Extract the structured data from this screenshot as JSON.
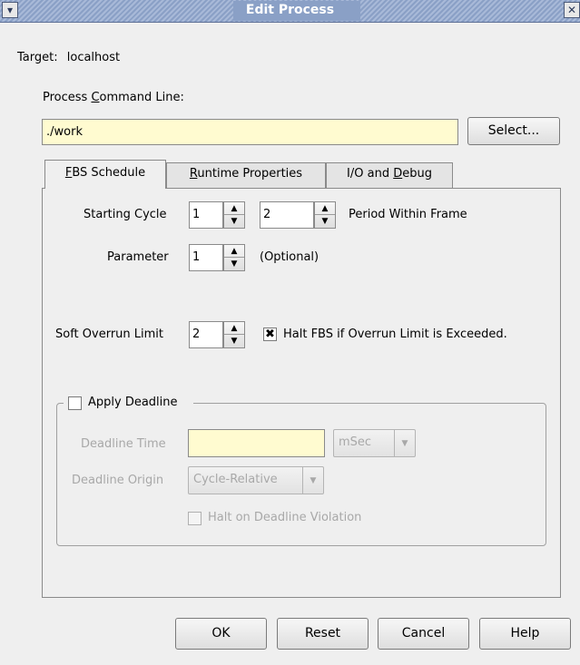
{
  "window": {
    "title": "Edit Process",
    "menu_glyph": "▾",
    "close_glyph": "✕"
  },
  "target": {
    "label": "Target:",
    "value": "localhost"
  },
  "command_line": {
    "label_before": "Process ",
    "label_mnemonic": "C",
    "label_after": "ommand Line:",
    "value": "./work",
    "select_button": "Select..."
  },
  "tabs": [
    {
      "mnemonic": "F",
      "rest": "BS Schedule",
      "prefix": "",
      "active": true
    },
    {
      "mnemonic": "R",
      "rest": "untime Properties",
      "prefix": "",
      "active": false
    },
    {
      "mnemonic": "D",
      "rest": "ebug",
      "prefix": "I/O and ",
      "active": false
    }
  ],
  "schedule": {
    "starting_cycle_label": "Starting Cycle",
    "starting_cycle_value": "1",
    "period_value": "2",
    "period_label": "Period Within Frame",
    "parameter_label": "Parameter",
    "parameter_value": "1",
    "parameter_hint": "(Optional)",
    "soft_overrun_label": "Soft Overrun Limit",
    "soft_overrun_value": "2",
    "halt_fbs_label": "Halt FBS if Overrun Limit is Exceeded.",
    "halt_fbs_checked": true
  },
  "deadline": {
    "apply_label": "Apply Deadline",
    "apply_checked": false,
    "time_label": "Deadline Time",
    "time_value": "",
    "time_unit": "mSec",
    "origin_label": "Deadline Origin",
    "origin_value": "Cycle-Relative",
    "halt_label": "Halt on Deadline Violation",
    "halt_checked": false
  },
  "buttons": {
    "ok": "OK",
    "reset": "Reset",
    "cancel": "Cancel",
    "help": "Help"
  },
  "glyphs": {
    "spin_up": "▲",
    "spin_down": "▼",
    "check_mark": "✖",
    "combo_arrow": "▼"
  }
}
